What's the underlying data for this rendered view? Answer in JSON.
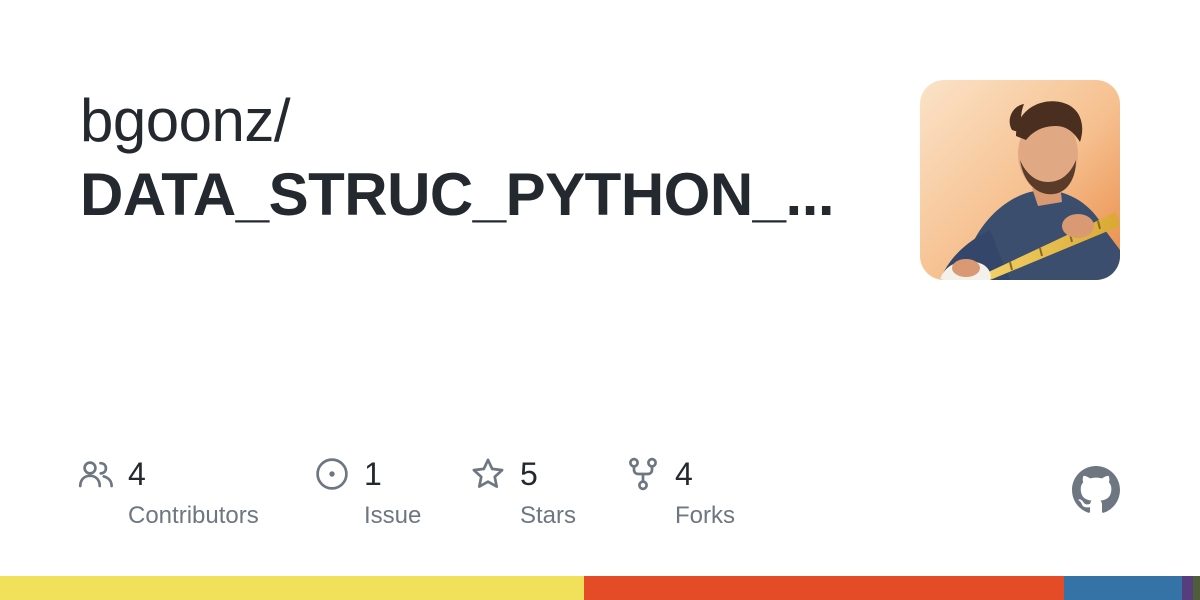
{
  "repo": {
    "owner": "bgoonz/",
    "name": "DATA_STRUC_PYTHON_..."
  },
  "stats": [
    {
      "icon": "people-icon",
      "count": "4",
      "label": "Contributors"
    },
    {
      "icon": "issue-icon",
      "count": "1",
      "label": "Issue"
    },
    {
      "icon": "star-icon",
      "count": "5",
      "label": "Stars"
    },
    {
      "icon": "fork-icon",
      "count": "4",
      "label": "Forks"
    }
  ],
  "colors": {
    "text_primary": "#24292f",
    "text_secondary": "#6e7781",
    "icon": "#6e7781",
    "logo": "#6e7781"
  },
  "language_bar": [
    {
      "color": "#f1e05a",
      "fraction": 0.487
    },
    {
      "color": "#e34c26",
      "fraction": 0.4
    },
    {
      "color": "#3572a5",
      "fraction": 0.098
    },
    {
      "color": "#563d7c",
      "fraction": 0.009
    },
    {
      "color": "#4f5d3b",
      "fraction": 0.006
    }
  ]
}
